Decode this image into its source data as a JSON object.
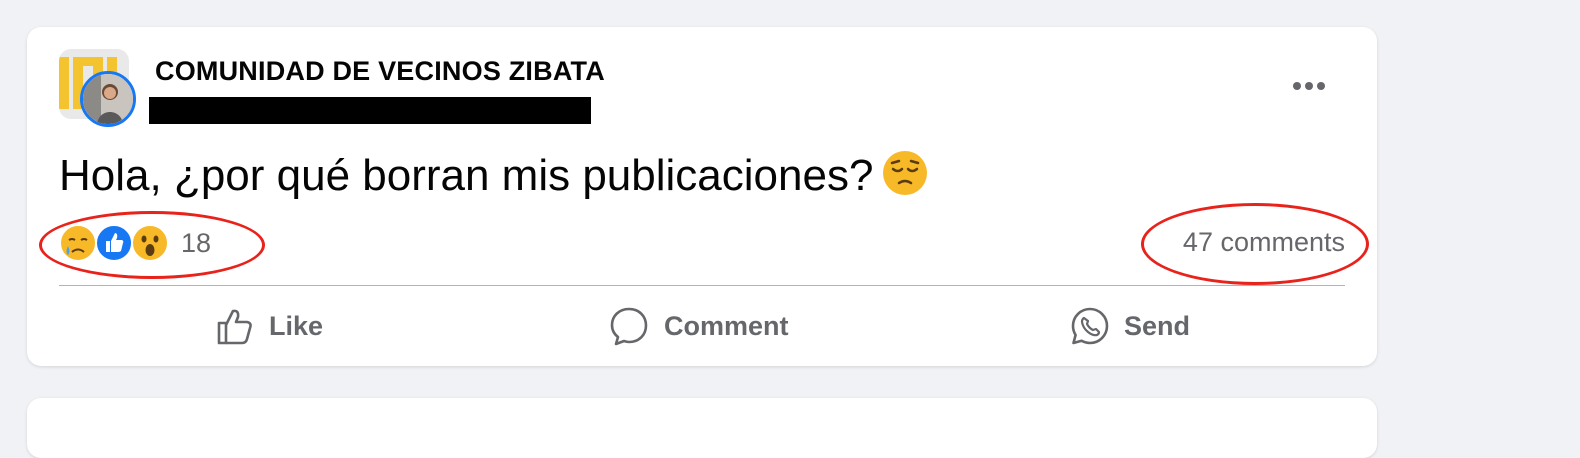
{
  "post": {
    "group_name": "COMUNIDAD DE VECINOS ZIBATA",
    "text": "Hola, ¿por qué borran mis publicaciones?",
    "text_emoji": "pensive-face-emoji",
    "reactions": {
      "icons": [
        "crying-face-reaction",
        "like-reaction",
        "wow-reaction"
      ],
      "count": "18"
    },
    "comments_label": "47 comments",
    "actions": {
      "like": "Like",
      "comment": "Comment",
      "send": "Send"
    }
  },
  "colors": {
    "background": "#f0f2f5",
    "card": "#ffffff",
    "text": "#050505",
    "secondary_text": "#65676b",
    "accent_blue": "#1877f2",
    "annotation_red": "#e8231b",
    "reaction_yellow": "#f7b928"
  }
}
